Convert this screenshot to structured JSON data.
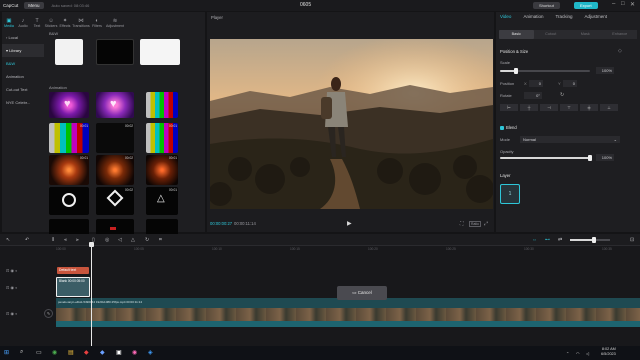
{
  "titlebar": {
    "app": "CapCut",
    "menu": "Menu",
    "autosave": "Auto saved: 08:03:46",
    "project": "0605",
    "shortcut": "Shortcut",
    "export": "Export",
    "window_controls": [
      "–",
      "□",
      "✕"
    ]
  },
  "toolbar": [
    {
      "label": "Media",
      "icon": "media-icon",
      "glyph": "▣"
    },
    {
      "label": "Audio",
      "icon": "audio-icon",
      "glyph": "♪"
    },
    {
      "label": "Text",
      "icon": "text-icon",
      "glyph": "T"
    },
    {
      "label": "Stickers",
      "icon": "stickers-icon",
      "glyph": "☺"
    },
    {
      "label": "Effects",
      "icon": "effects-icon",
      "glyph": "✦"
    },
    {
      "label": "Transitions",
      "icon": "transitions-icon",
      "glyph": "⋈"
    },
    {
      "label": "Filters",
      "icon": "filters-icon",
      "glyph": "◐"
    },
    {
      "label": "Adjustment",
      "icon": "adjustment-icon",
      "glyph": "≋"
    }
  ],
  "sidenav": {
    "local": "Local",
    "library": "Library",
    "items": [
      "B&W",
      "Animation",
      "Cut-out Text",
      "NYE Celebr..."
    ]
  },
  "library": {
    "bw_label": "B&W",
    "animation_label": "Animation",
    "badges": [
      "00:01",
      "00:02",
      "00:01",
      "00:01",
      "00:02",
      "00:01",
      "00:02",
      "00:01"
    ]
  },
  "player": {
    "title": "Player",
    "current_time": "00:00:00:27",
    "total_time": "00:00:11:14",
    "play_glyph": "▶",
    "ratio_label": "Ratio"
  },
  "inspector": {
    "tabs": [
      "Video",
      "Animation",
      "Tracking",
      "Adjustment"
    ],
    "subtabs": [
      "Basic",
      "Cutout",
      "Mask",
      "Enhance"
    ],
    "position_size": "Position & Size",
    "scale_label": "Scale",
    "scale_value": "100%",
    "scale_fraction": 0.18,
    "position_label": "Position",
    "pos_x_axis": "X",
    "pos_x": "0",
    "pos_y_axis": "Y",
    "pos_y": "0",
    "rotate_label": "Rotate",
    "rotate_value": "0°",
    "blend_title": "Blend",
    "mode_label": "Mode",
    "mode_value": "Normal",
    "opacity_label": "Opacity",
    "opacity_value": "100%",
    "opacity_fraction": 1.0,
    "layer_title": "Layer",
    "layer_value": "1"
  },
  "timeline": {
    "ruler": [
      "100:00",
      "100:05",
      "100:10",
      "100:15",
      "100:20",
      "100:25",
      "100:30",
      "100:35",
      "100:40",
      "100:45"
    ],
    "text_clip": "Default text",
    "sel_clip": "Blank 00:00:05:00",
    "main_clip": "pexels-taryn-elliott-5490044 1920x1080 25fps.mp4 00:00:11:14",
    "cancel": "Cancel",
    "zoom_fraction": 0.6
  },
  "taskbar": {
    "time": "8:02 AM",
    "date": "6/5/2023"
  },
  "colors": {
    "accent": "#2ec6d8",
    "export": "#20b8c8",
    "text_clip": "#c8553d"
  }
}
